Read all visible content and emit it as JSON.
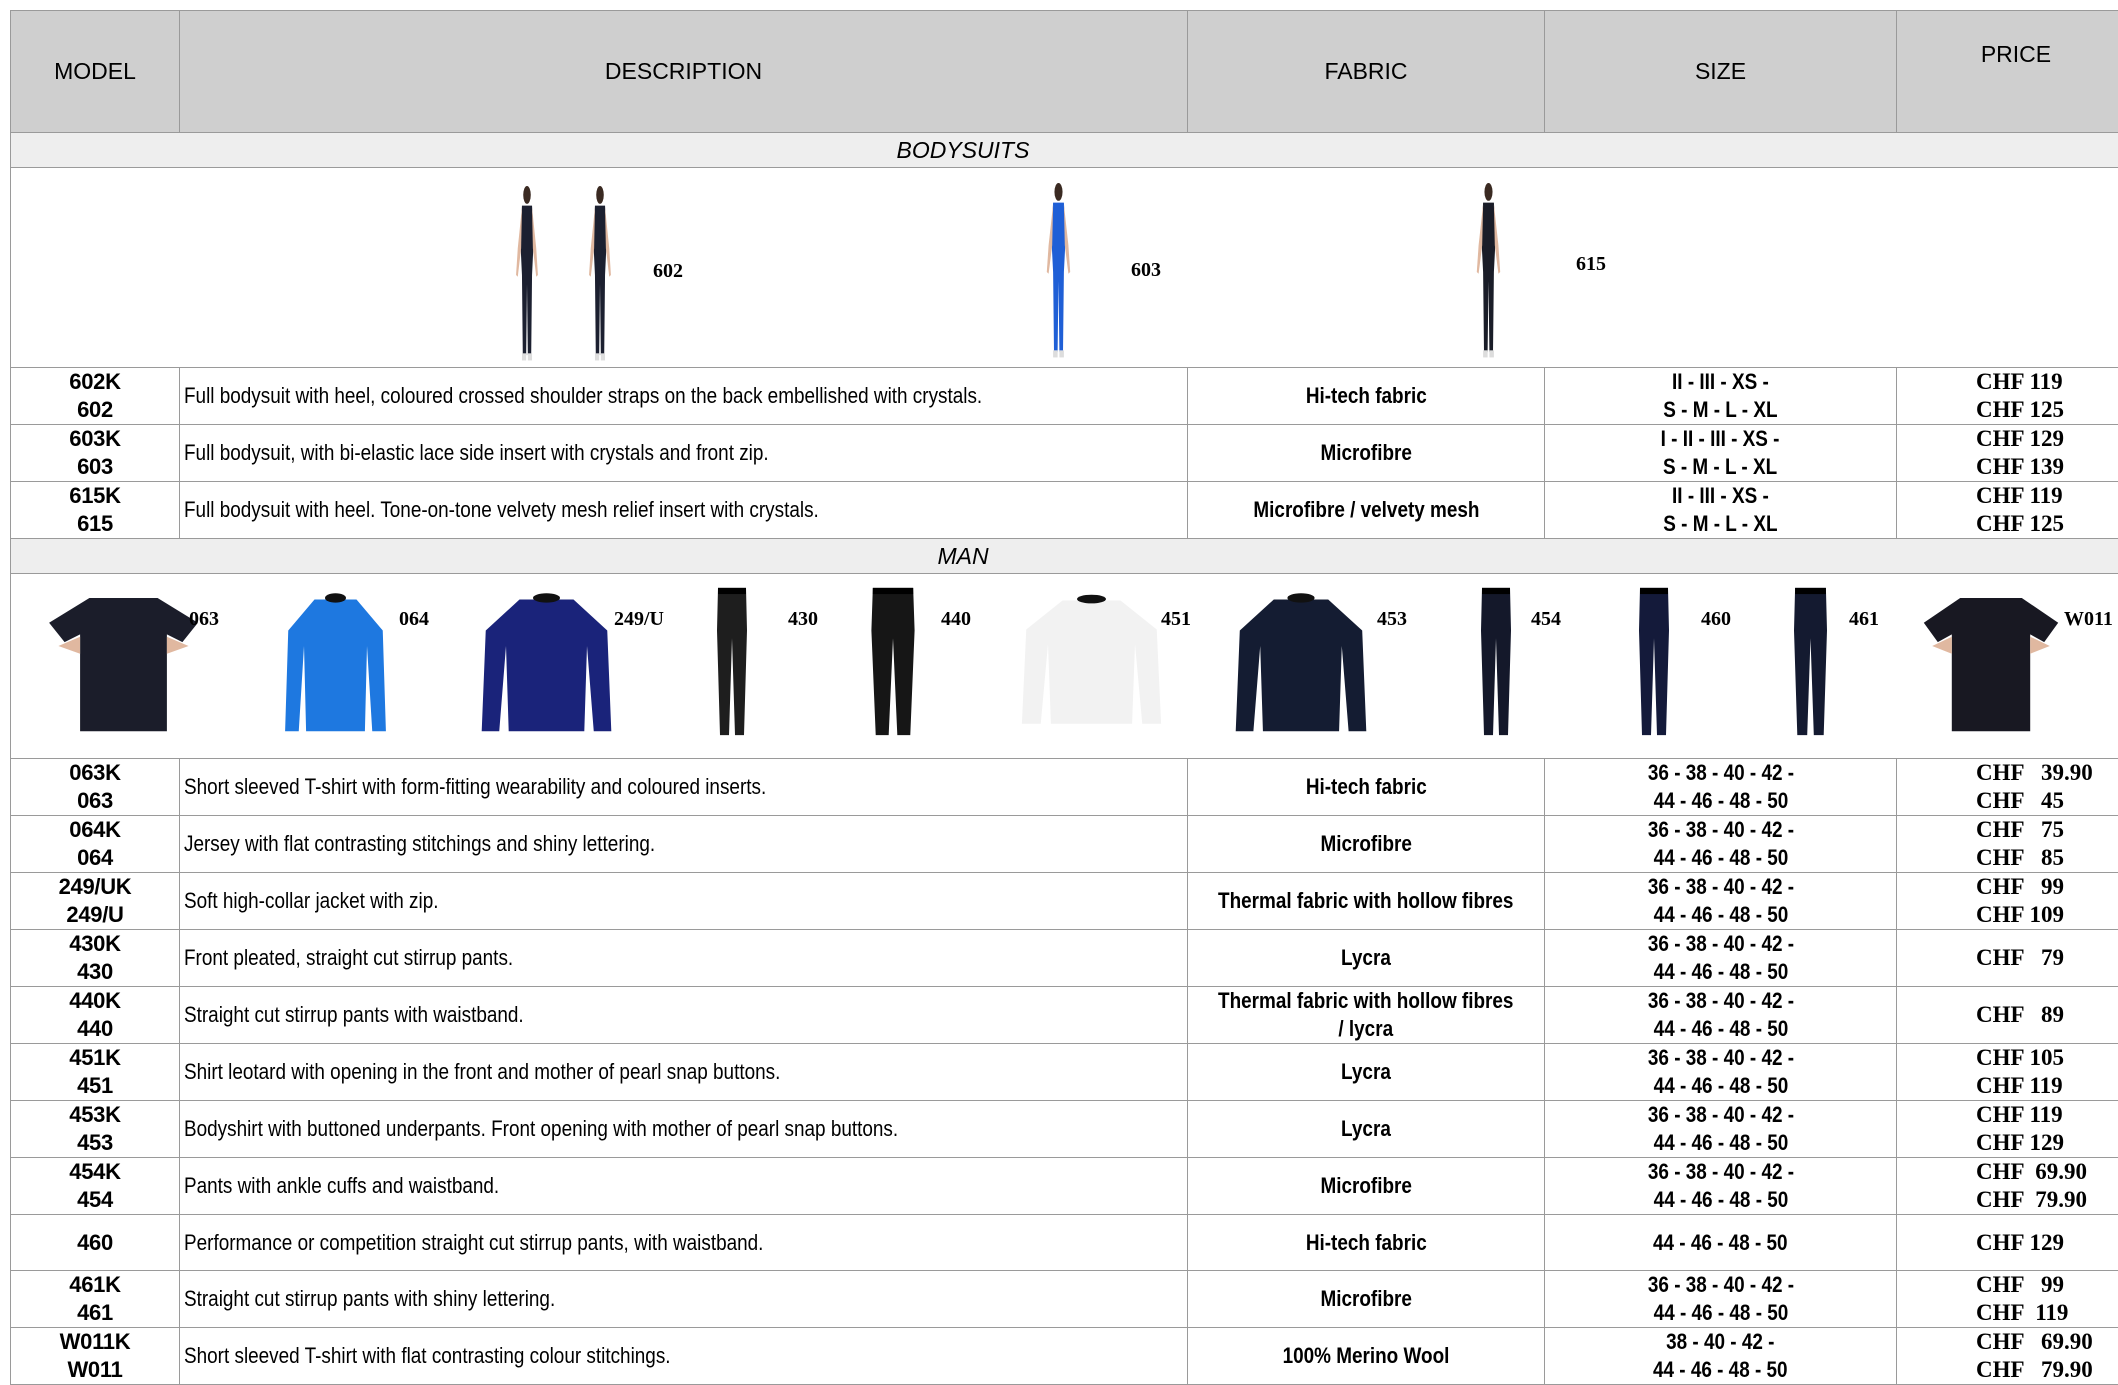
{
  "header": {
    "model": "MODEL",
    "description": "DESCRIPTION",
    "fabric": "FABRIC",
    "size": "SIZE",
    "price": "PRICE"
  },
  "sections": {
    "bodysuits": "BODYSUITS",
    "man": "MAN"
  },
  "bodysuit_image_labels": [
    "602",
    "603",
    "615"
  ],
  "man_image_labels": [
    "063",
    "064",
    "249/U",
    "430",
    "440",
    "451",
    "453",
    "454",
    "460",
    "461",
    "W011"
  ],
  "bodysuit_rows": [
    {
      "model": "602K\n602",
      "description": "Full bodysuit with heel, coloured crossed shoulder straps on the back embellished with crystals.",
      "fabric": "Hi-tech fabric",
      "size": "II - III - XS -\nS - M - L - XL",
      "price": "CHF 119\nCHF 125"
    },
    {
      "model": "603K\n603",
      "description": "Full bodysuit, with bi-elastic lace side insert with crystals and front zip.",
      "fabric": "Microfibre",
      "size": "I - II - III - XS -\nS - M - L - XL",
      "price": "CHF 129\nCHF 139"
    },
    {
      "model": "615K\n615",
      "description": "Full bodysuit with heel. Tone-on-tone velvety mesh relief insert with crystals.",
      "fabric": "Microfibre / velvety mesh",
      "size": "II - III - XS -\nS - M - L - XL",
      "price": "CHF 119\nCHF 125"
    }
  ],
  "man_rows": [
    {
      "model": "063K\n063",
      "description": "Short sleeved T-shirt with form-fitting wearability and coloured inserts.",
      "fabric": "Hi-tech fabric",
      "size": "36 - 38 - 40 - 42 -\n44 - 46 - 48 - 50",
      "price": "CHF   39.90\nCHF   45"
    },
    {
      "model": "064K\n064",
      "description": "Jersey with flat contrasting stitchings and shiny lettering.",
      "fabric": "Microfibre",
      "size": "36 - 38 - 40 - 42 -\n44 - 46 - 48 - 50",
      "price": "CHF   75\nCHF   85"
    },
    {
      "model": "249/UK\n249/U",
      "description": "Soft high-collar jacket with zip.",
      "fabric": "Thermal fabric with hollow fibres",
      "size": "36 - 38 - 40 - 42 -\n44 - 46 - 48 - 50",
      "price": "CHF   99\nCHF 109"
    },
    {
      "model": "430K\n430",
      "description": "Front pleated, straight cut stirrup pants.",
      "fabric": "Lycra",
      "size": "36 - 38 - 40 - 42 -\n44 - 46 - 48 - 50",
      "price": "CHF   79"
    },
    {
      "model": "440K\n440",
      "description": "Straight cut stirrup pants with waistband.",
      "fabric": "Thermal fabric with hollow fibres\n/ lycra",
      "size": "36 - 38 - 40 - 42 -\n44 - 46 - 48 - 50",
      "price": "CHF   89"
    },
    {
      "model": "451K\n451",
      "description": "Shirt leotard with opening in the front and mother of pearl snap buttons.",
      "fabric": "Lycra",
      "size": "36 - 38 - 40 - 42 -\n44 - 46 - 48 - 50",
      "price": "CHF 105\nCHF 119"
    },
    {
      "model": "453K\n453",
      "description": "Bodyshirt with buttoned underpants. Front opening with mother of pearl snap buttons.",
      "fabric": "Lycra",
      "size": "36 - 38 - 40 - 42 -\n44 - 46 - 48 - 50",
      "price": "CHF 119\nCHF 129"
    },
    {
      "model": "454K\n454",
      "description": "Pants with ankle cuffs and waistband.",
      "fabric": "Microfibre",
      "size": "36 - 38 - 40 - 42 -\n44 - 46 - 48 - 50",
      "price": "CHF  69.90\nCHF  79.90"
    },
    {
      "model": "460",
      "description": "Performance or competition straight cut stirrup pants, with waistband.",
      "fabric": "Hi-tech fabric",
      "size": "44 - 46 - 48 - 50",
      "price": "CHF 129"
    },
    {
      "model": "461K\n461",
      "description": "Straight cut stirrup pants with shiny lettering.",
      "fabric": "Microfibre",
      "size": "36 - 38 - 40 - 42 -\n44 - 46 - 48 - 50",
      "price": "CHF   99\nCHF  119"
    },
    {
      "model": "W011K\nW011",
      "description": "Short sleeved T-shirt with flat contrasting colour stitchings.",
      "fabric": "100% Merino Wool",
      "size": "38 - 40 - 42 -\n44 - 46 - 48 - 50",
      "price": "CHF   69.90\nCHF   79.90"
    }
  ]
}
